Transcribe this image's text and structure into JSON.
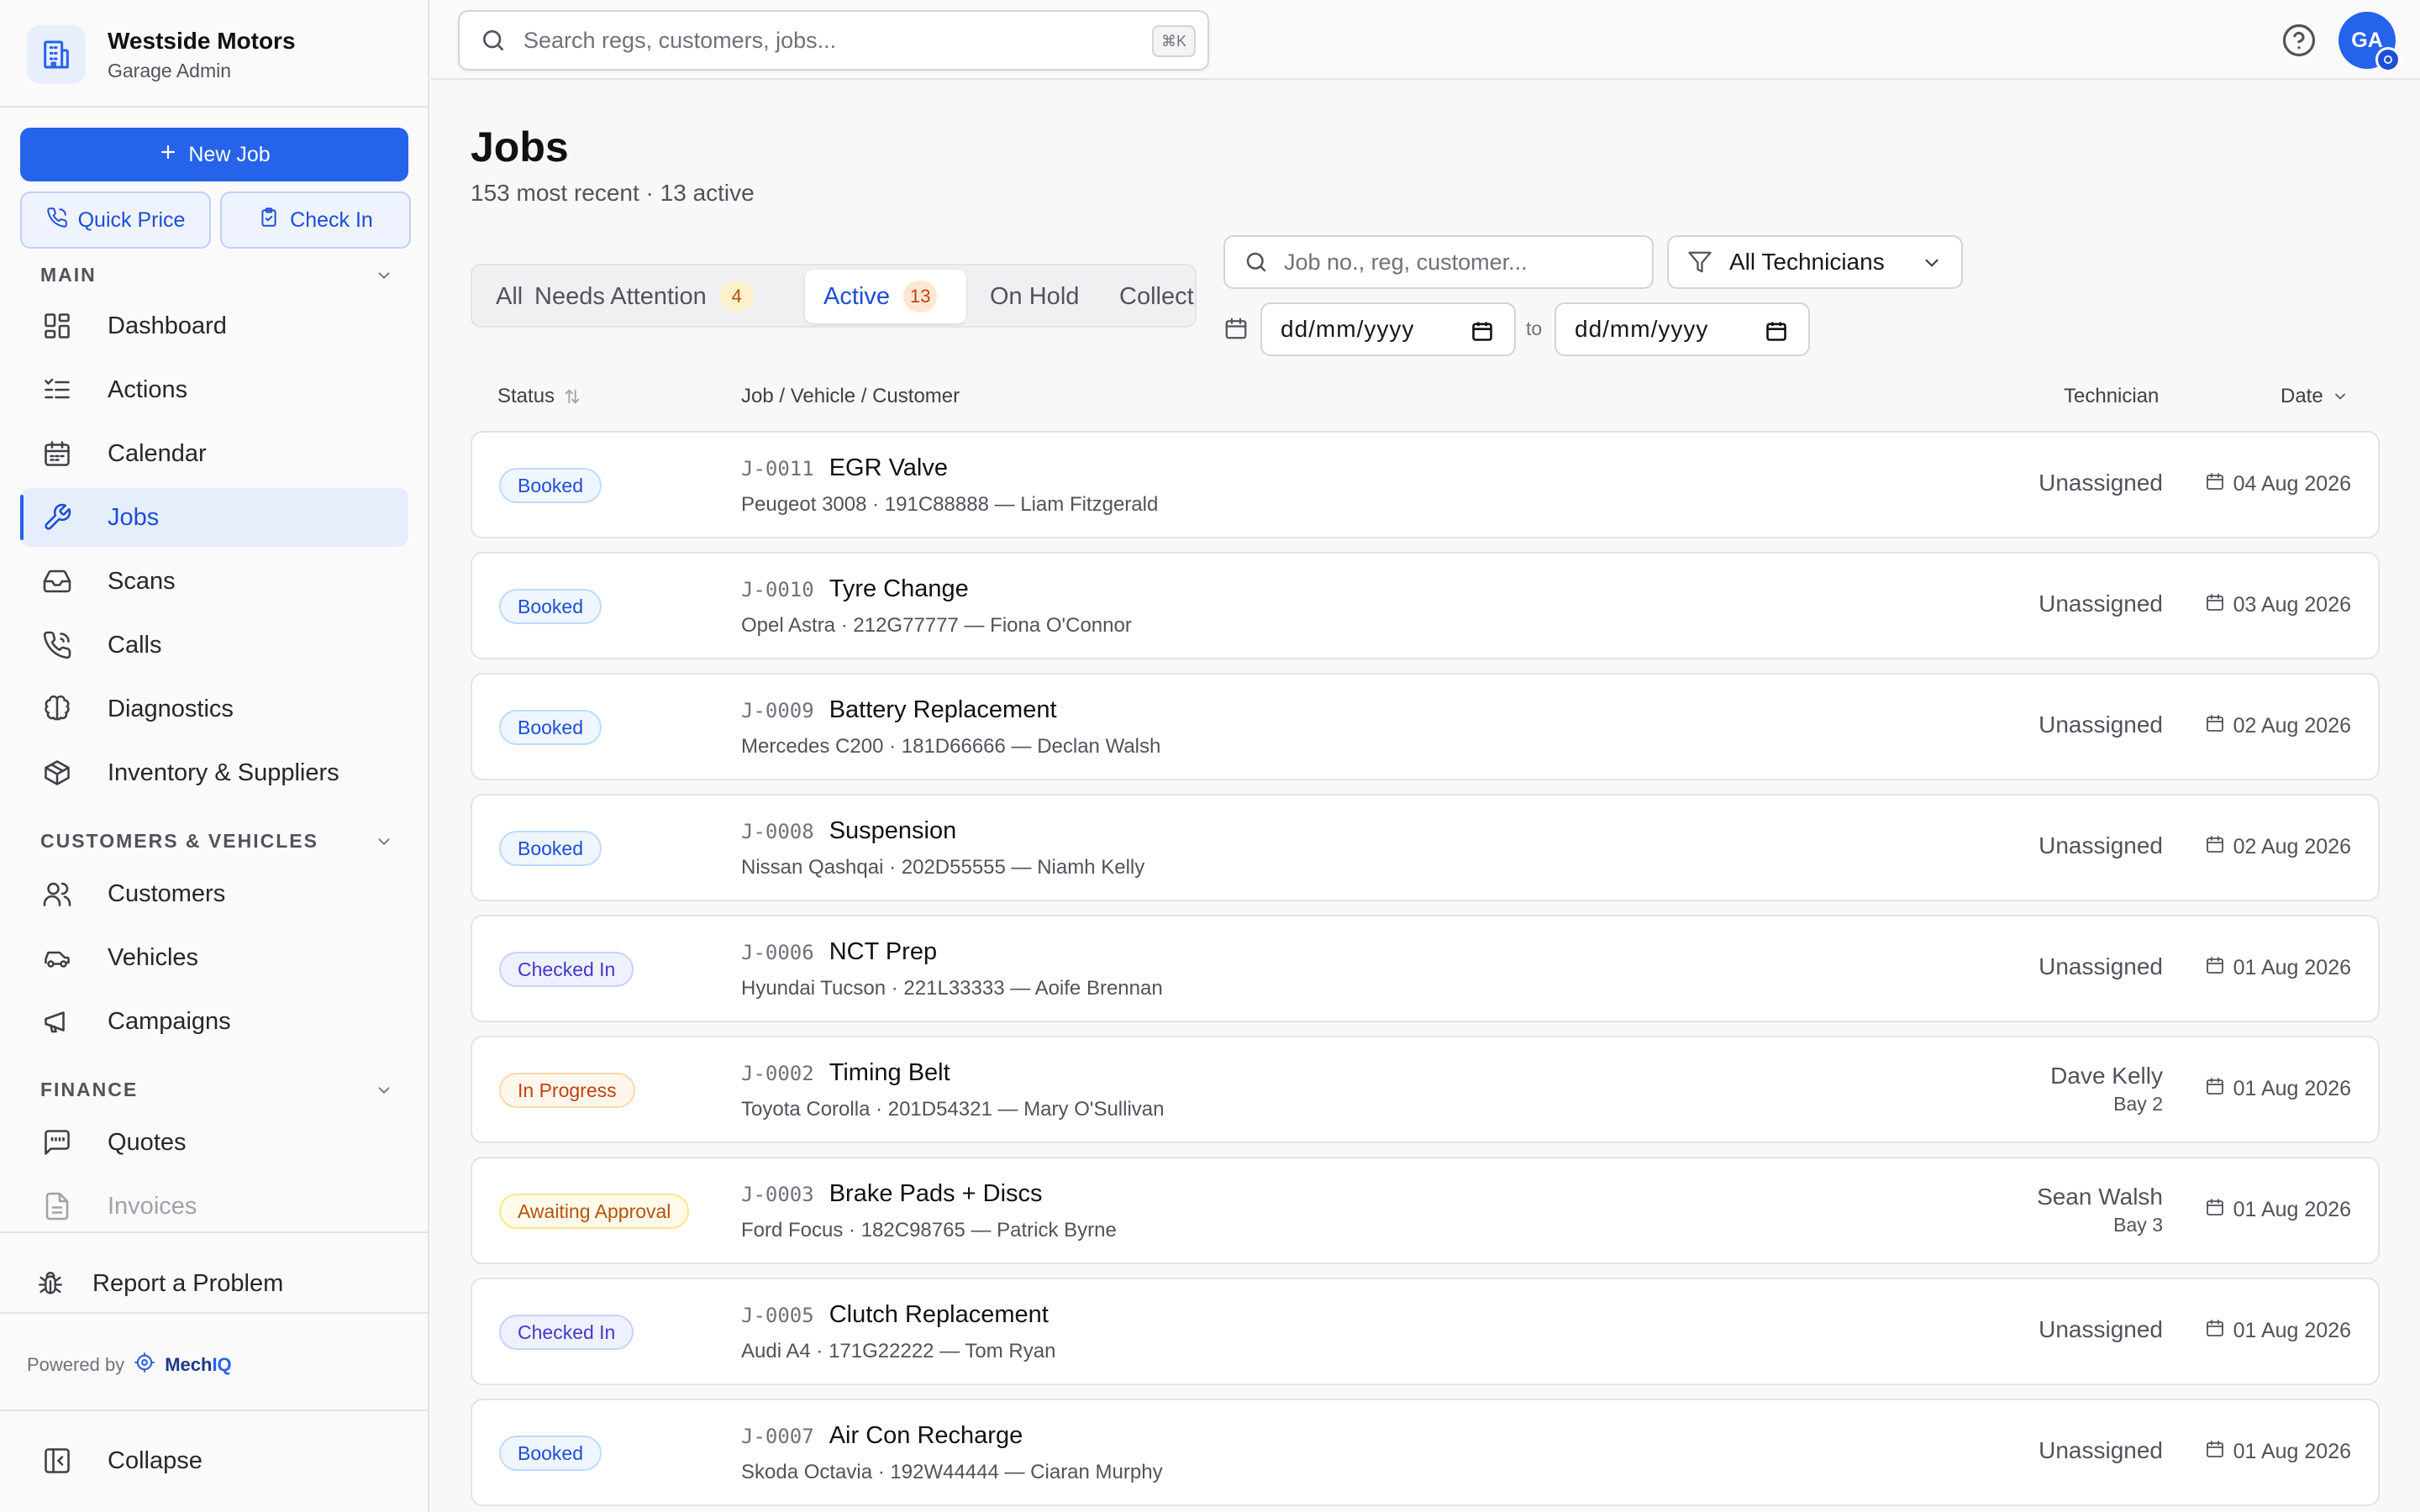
{
  "brand": {
    "name": "Westside Motors",
    "subtitle": "Garage Admin"
  },
  "actions": {
    "new_job": "New Job",
    "quick_price": "Quick Price",
    "check_in": "Check In"
  },
  "sidebar": {
    "sections": [
      {
        "title": "MAIN"
      },
      {
        "title": "CUSTOMERS & VEHICLES"
      },
      {
        "title": "FINANCE"
      }
    ],
    "items": [
      {
        "label": "Dashboard",
        "icon": "dashboard-icon"
      },
      {
        "label": "Actions",
        "icon": "list-checks-icon"
      },
      {
        "label": "Calendar",
        "icon": "calendar-icon"
      },
      {
        "label": "Jobs",
        "icon": "wrench-icon",
        "active": true
      },
      {
        "label": "Scans",
        "icon": "inbox-icon"
      },
      {
        "label": "Calls",
        "icon": "phone-icon"
      },
      {
        "label": "Diagnostics",
        "icon": "brain-icon"
      },
      {
        "label": "Inventory & Suppliers",
        "icon": "package-icon"
      },
      {
        "label": "Customers",
        "icon": "users-icon"
      },
      {
        "label": "Vehicles",
        "icon": "car-icon"
      },
      {
        "label": "Campaigns",
        "icon": "megaphone-icon"
      },
      {
        "label": "Quotes",
        "icon": "quote-icon"
      },
      {
        "label": "Invoices",
        "icon": "file-icon"
      }
    ],
    "report": "Report a Problem",
    "powered_by": "Powered by",
    "powered_brand_a": "Mech",
    "powered_brand_b": "IQ",
    "collapse": "Collapse"
  },
  "topbar": {
    "search_placeholder": "Search regs, customers, jobs...",
    "shortcut": "⌘K",
    "avatar_initials": "GA"
  },
  "page": {
    "title": "Jobs",
    "subtitle": "153 most recent · 13 active"
  },
  "tabs": [
    {
      "label": "All"
    },
    {
      "label": "Needs Attention",
      "count": "4"
    },
    {
      "label": "Active",
      "count": "13",
      "active": true
    },
    {
      "label": "On Hold"
    },
    {
      "label": "Collect"
    }
  ],
  "filters": {
    "search_placeholder": "Job no., reg, customer...",
    "technician": "All Technicians",
    "date_from": "dd/mm/yyyy",
    "date_to": "dd/mm/yyyy",
    "to_label": "to"
  },
  "columns": {
    "status": "Status",
    "job": "Job / Vehicle / Customer",
    "technician": "Technician",
    "date": "Date"
  },
  "status_colors": {
    "booked": "#1d4ed8",
    "checked_in": "#4338ca",
    "in_progress": "#c2410c",
    "awaiting_approval": "#b45309"
  },
  "jobs": [
    {
      "status": "Booked",
      "status_class": "booked",
      "job_no": "J-0011",
      "title": "EGR Valve",
      "meta": "Peugeot 3008 · 191C88888 — Liam Fitzgerald",
      "technician": "Unassigned",
      "bay": "",
      "date": "04 Aug 2026"
    },
    {
      "status": "Booked",
      "status_class": "booked",
      "job_no": "J-0010",
      "title": "Tyre Change",
      "meta": "Opel Astra · 212G77777 — Fiona O'Connor",
      "technician": "Unassigned",
      "bay": "",
      "date": "03 Aug 2026"
    },
    {
      "status": "Booked",
      "status_class": "booked",
      "job_no": "J-0009",
      "title": "Battery Replacement",
      "meta": "Mercedes C200 · 181D66666 — Declan Walsh",
      "technician": "Unassigned",
      "bay": "",
      "date": "02 Aug 2026"
    },
    {
      "status": "Booked",
      "status_class": "booked",
      "job_no": "J-0008",
      "title": "Suspension",
      "meta": "Nissan Qashqai · 202D55555 — Niamh Kelly",
      "technician": "Unassigned",
      "bay": "",
      "date": "02 Aug 2026"
    },
    {
      "status": "Checked In",
      "status_class": "checked",
      "job_no": "J-0006",
      "title": "NCT Prep",
      "meta": "Hyundai Tucson · 221L33333 — Aoife Brennan",
      "technician": "Unassigned",
      "bay": "",
      "date": "01 Aug 2026"
    },
    {
      "status": "In Progress",
      "status_class": "progress",
      "job_no": "J-0002",
      "title": "Timing Belt",
      "meta": "Toyota Corolla · 201D54321 — Mary O'Sullivan",
      "technician": "Dave Kelly",
      "bay": "Bay 2",
      "date": "01 Aug 2026"
    },
    {
      "status": "Awaiting Approval",
      "status_class": "awaiting",
      "job_no": "J-0003",
      "title": "Brake Pads + Discs",
      "meta": "Ford Focus · 182C98765 — Patrick Byrne",
      "technician": "Sean Walsh",
      "bay": "Bay 3",
      "date": "01 Aug 2026"
    },
    {
      "status": "Checked In",
      "status_class": "checked",
      "job_no": "J-0005",
      "title": "Clutch Replacement",
      "meta": "Audi A4 · 171G22222 — Tom Ryan",
      "technician": "Unassigned",
      "bay": "",
      "date": "01 Aug 2026"
    },
    {
      "status": "Booked",
      "status_class": "booked",
      "job_no": "J-0007",
      "title": "Air Con Recharge",
      "meta": "Skoda Octavia · 192W44444 — Ciaran Murphy",
      "technician": "Unassigned",
      "bay": "",
      "date": "01 Aug 2026"
    }
  ]
}
